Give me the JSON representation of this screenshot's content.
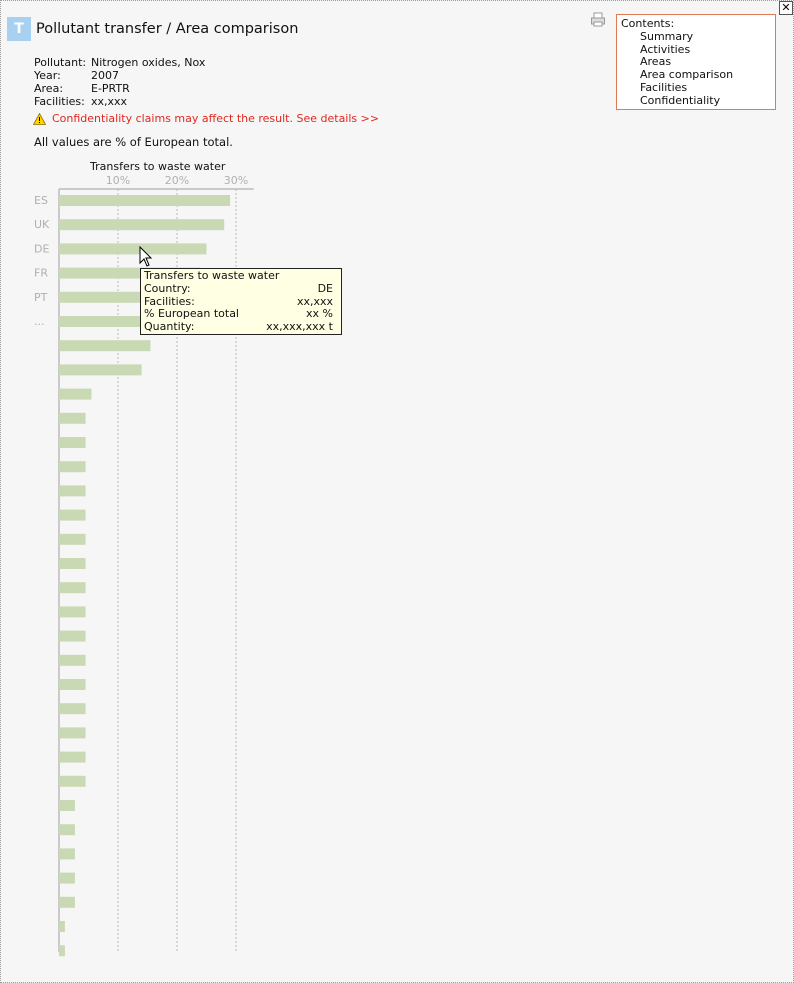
{
  "window": {
    "close_symbol": "✕"
  },
  "header": {
    "badge": "T",
    "title": "Pollutant transfer / Area comparison",
    "print_icon": "printer-icon"
  },
  "contents": {
    "heading": "Contents:",
    "items": [
      "Summary",
      "Activities",
      "Areas",
      "Area comparison",
      "Facilities",
      "Confidentiality"
    ]
  },
  "meta": {
    "pollutant_label": "Pollutant:",
    "pollutant": "Nitrogen oxides, Nox",
    "year_label": "Year:",
    "year": "2007",
    "area_label": "Area:",
    "area": "E-PRTR",
    "facilities_label": "Facilities:",
    "facilities": "xx,xxx"
  },
  "warning": {
    "icon": "warning-icon",
    "text": "Confidentiality claims may affect the result. See details >>"
  },
  "note": "All values are % of European total.",
  "chart_data": {
    "type": "bar",
    "orientation": "horizontal",
    "title": "Transfers to waste water",
    "x_ticks": [
      "10%",
      "20%",
      "30%"
    ],
    "xlim": [
      0,
      33
    ],
    "grid": true,
    "categories": [
      "ES",
      "UK",
      "DE",
      "FR",
      "PT",
      "...",
      "",
      "",
      "",
      "",
      "",
      "",
      "",
      "",
      "",
      "",
      "",
      "",
      "",
      "",
      "",
      "",
      "",
      "",
      "",
      "",
      "",
      "",
      "",
      "",
      "",
      "",
      ""
    ],
    "values": [
      29,
      28,
      25,
      24,
      23,
      22,
      15.5,
      14,
      5.5,
      4.5,
      4.5,
      4.5,
      4.5,
      4.5,
      4.5,
      4.5,
      4.5,
      4.5,
      4.5,
      4.5,
      4.5,
      4.5,
      4.5,
      4.5,
      4.5,
      2.7,
      2.7,
      2.7,
      2.7,
      2.7,
      1,
      1
    ],
    "bar_color": "#c9d9b3",
    "grid_color": "#bbbbbb",
    "label_color": "#b0b0b0"
  },
  "tooltip": {
    "title": "Transfers to waste water",
    "rows": [
      {
        "label": "Country:",
        "value": "DE"
      },
      {
        "label": "Facilities:",
        "value": "xx,xxx"
      },
      {
        "label": "% European total",
        "value": "xx %"
      },
      {
        "label": "Quantity:",
        "value": "xx,xxx,xxx t"
      }
    ]
  }
}
